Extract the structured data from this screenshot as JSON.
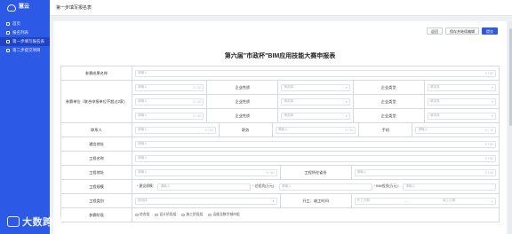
{
  "sidebar": {
    "brand": "慧云",
    "brand_sub": "",
    "items": [
      {
        "label": "首页"
      },
      {
        "label": "报名列表"
      },
      {
        "label": "第一步填写报名表"
      },
      {
        "label": "第二步提交项目"
      }
    ]
  },
  "topbar": {
    "title": "第一步填写报名表"
  },
  "actions": {
    "back": "返回",
    "save_draft": "保存并继续编辑",
    "submit": "提交"
  },
  "form": {
    "title": "第六届\"市政杯\"BIM应用技能大赛申报表",
    "placeholder": "请输入",
    "select_placeholder": "请选择",
    "count_20": "0 / 20",
    "count_50": "0 / 50",
    "count_11": "0 / 11",
    "labels": {
      "achievement": "参赛成果名称",
      "units": "参赛单位（联合申报单位不超过3家）",
      "unit_nature": "企业性质",
      "unit_type": "企业类型",
      "contact": "联系人",
      "position": "职务",
      "phone": "手机",
      "address": "通信地址",
      "project_name": "工程名称",
      "project_location": "工程地址",
      "project_investment": "工程所在省份",
      "project_scale": "工程规模",
      "building_area": "建设规模：",
      "total_invest": "总投资(万元)：",
      "bim_invest": "BIM投资(万元)：",
      "project_category": "工程类别",
      "start_end": "开工、竣工时间",
      "start_time": "开工日期",
      "end_time": "竣工日期",
      "stage": "参赛阶段"
    },
    "stages": [
      "综合组",
      "设计阶段组",
      "施工阶段组",
      "运维及数字城市组"
    ],
    "end_sep": "—"
  },
  "watermark": {
    "text": "大数跨境"
  }
}
